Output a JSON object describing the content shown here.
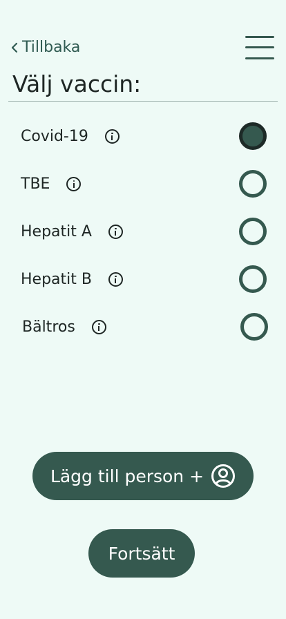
{
  "nav": {
    "back_label": "Tillbaka",
    "back_icon": "chevron-left-icon",
    "menu_icon": "hamburger-menu-icon"
  },
  "page": {
    "title": "Välj vaccin:"
  },
  "vaccines": [
    {
      "label": "Covid-19",
      "selected": true
    },
    {
      "label": "TBE",
      "selected": false
    },
    {
      "label": "Hepatit A",
      "selected": false
    },
    {
      "label": "Hepatit B",
      "selected": false
    },
    {
      "label": "Bältros",
      "selected": false
    }
  ],
  "actions": {
    "add_person_label": "Lägg till person +",
    "add_person_icon": "user-circle-icon",
    "continue_label": "Fortsätt"
  },
  "colors": {
    "background": "#eefaf6",
    "accent": "#35594f",
    "text": "#1e2624"
  }
}
